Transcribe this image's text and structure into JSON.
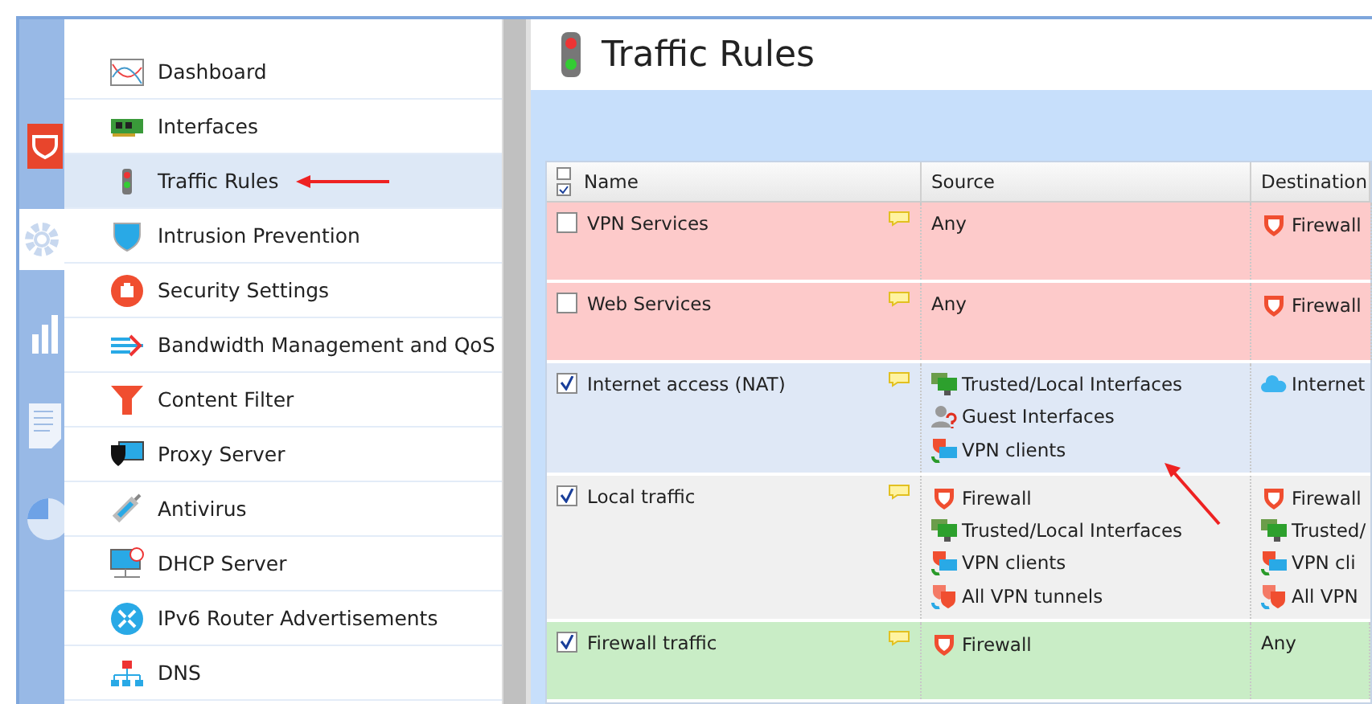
{
  "rail": [
    {
      "selected": false
    },
    {
      "selected": true
    },
    {
      "selected": false
    },
    {
      "selected": false
    },
    {
      "selected": false
    }
  ],
  "sidebar": {
    "items": [
      {
        "label": "Dashboard",
        "selected": false
      },
      {
        "label": "Interfaces",
        "selected": false
      },
      {
        "label": "Traffic Rules",
        "selected": true
      },
      {
        "label": "Intrusion Prevention",
        "selected": false
      },
      {
        "label": "Security Settings",
        "selected": false
      },
      {
        "label": "Bandwidth Management and QoS",
        "selected": false
      },
      {
        "label": "Content Filter",
        "selected": false
      },
      {
        "label": "Proxy Server",
        "selected": false
      },
      {
        "label": "Antivirus",
        "selected": false
      },
      {
        "label": "DHCP Server",
        "selected": false
      },
      {
        "label": "IPv6 Router Advertisements",
        "selected": false
      },
      {
        "label": "DNS",
        "selected": false
      }
    ]
  },
  "page": {
    "title": "Traffic Rules"
  },
  "table": {
    "columns": [
      "Name",
      "Source",
      "Destination"
    ],
    "rows": [
      {
        "name": "VPN Services",
        "checked": false,
        "color": "#fdcaca",
        "source": [
          {
            "kind": "any",
            "label": "Any"
          }
        ],
        "destination": [
          {
            "kind": "firewall",
            "label": "Firewall"
          }
        ]
      },
      {
        "name": "Web Services",
        "checked": false,
        "color": "#fdcaca",
        "source": [
          {
            "kind": "any",
            "label": "Any"
          }
        ],
        "destination": [
          {
            "kind": "firewall",
            "label": "Firewall"
          }
        ]
      },
      {
        "name": "Internet access (NAT)",
        "checked": true,
        "color": "#dfe8f6",
        "source": [
          {
            "kind": "trusted",
            "label": "Trusted/Local Interfaces"
          },
          {
            "kind": "guest",
            "label": "Guest Interfaces"
          },
          {
            "kind": "vpnclients",
            "label": "VPN clients"
          }
        ],
        "destination": [
          {
            "kind": "internet",
            "label": "Internet"
          }
        ]
      },
      {
        "name": "Local traffic",
        "checked": true,
        "color": "#f0f0f0",
        "source": [
          {
            "kind": "firewall",
            "label": "Firewall"
          },
          {
            "kind": "trusted",
            "label": "Trusted/Local Interfaces"
          },
          {
            "kind": "vpnclients",
            "label": "VPN clients"
          },
          {
            "kind": "vpntunnels",
            "label": "All VPN tunnels"
          }
        ],
        "destination": [
          {
            "kind": "firewall",
            "label": "Firewall"
          },
          {
            "kind": "trusted",
            "label": "Trusted/"
          },
          {
            "kind": "vpnclients",
            "label": "VPN cli"
          },
          {
            "kind": "vpntunnels",
            "label": "All VPN"
          }
        ]
      },
      {
        "name": "Firewall traffic",
        "checked": true,
        "color": "#c9edc6",
        "source": [
          {
            "kind": "firewall",
            "label": "Firewall"
          }
        ],
        "destination": [
          {
            "kind": "any",
            "label": "Any"
          }
        ]
      }
    ]
  }
}
